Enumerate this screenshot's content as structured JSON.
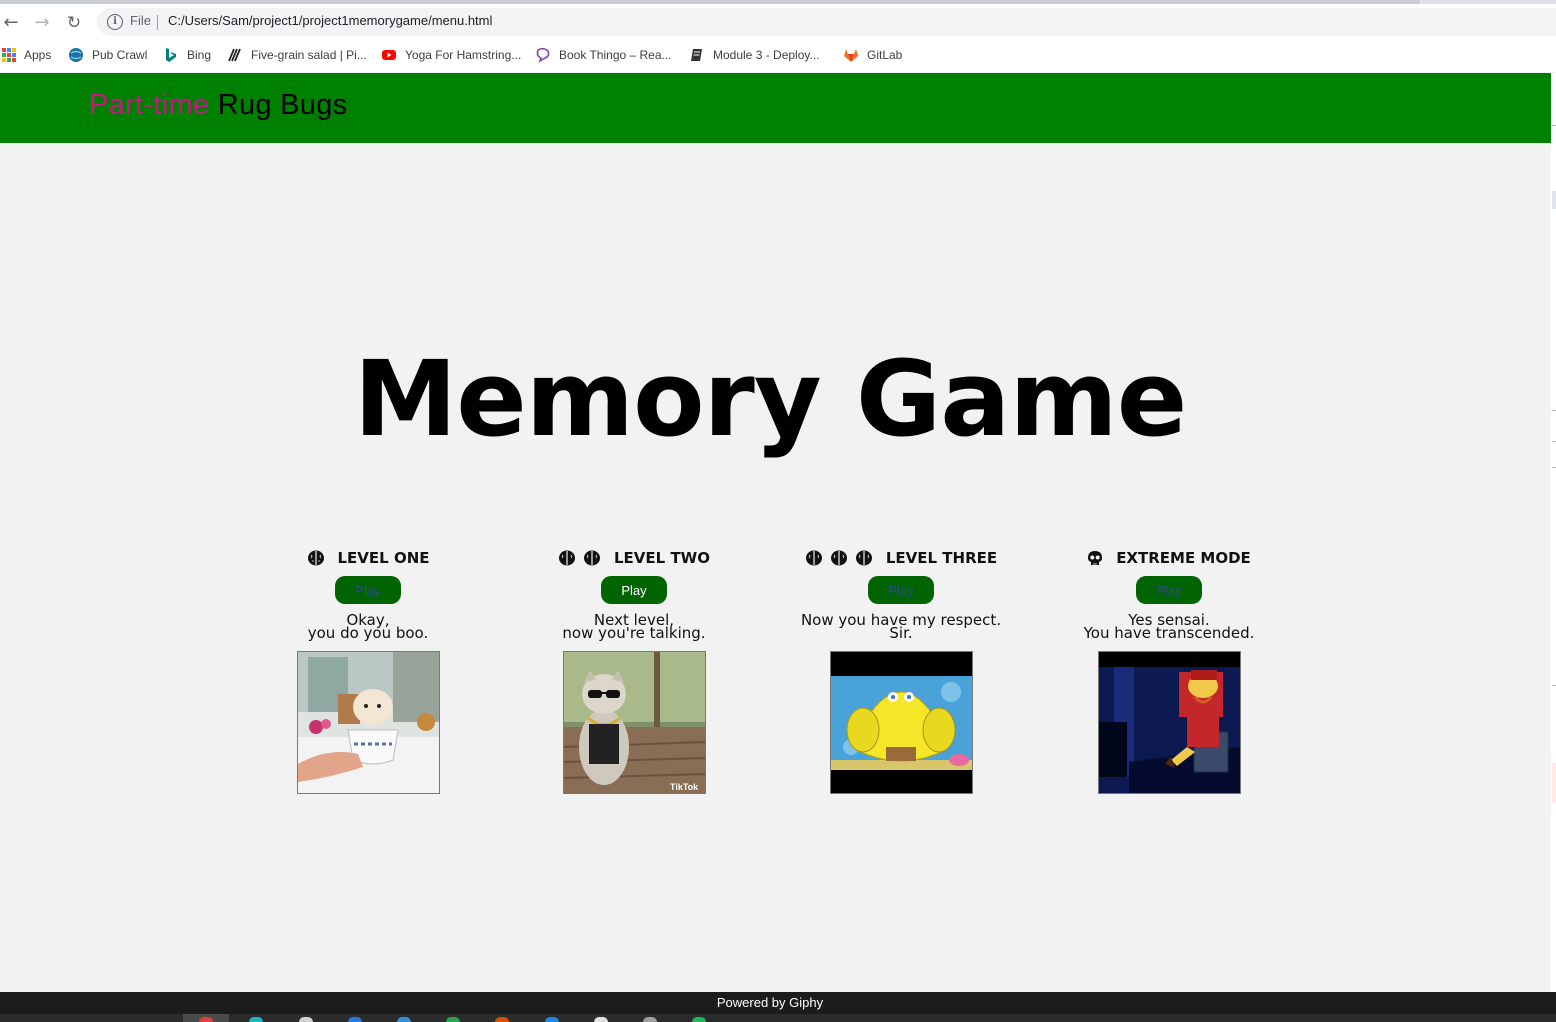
{
  "browser": {
    "url_scheme_label": "File",
    "url": "C:/Users/Sam/project1/project1memorygame/menu.html",
    "bookmarks": [
      {
        "label": "Apps",
        "icon": "apps-grid-icon"
      },
      {
        "label": "Pub Crawl",
        "icon": "globe-icon"
      },
      {
        "label": "Bing",
        "icon": "bing-icon"
      },
      {
        "label": "Five-grain salad | Pi...",
        "icon": "fork-icon"
      },
      {
        "label": "Yoga For Hamstring...",
        "icon": "youtube-icon"
      },
      {
        "label": "Book Thingo – Rea...",
        "icon": "chat-bubble-icon"
      },
      {
        "label": "Module 3 - Deploy...",
        "icon": "notebook-icon"
      },
      {
        "label": "GitLab",
        "icon": "gitlab-icon"
      }
    ]
  },
  "header": {
    "brand_accent": "Part-time",
    "brand_main": "Rug Bugs",
    "background_color": "#008000",
    "accent_color": "#c71585"
  },
  "main": {
    "title": "Memory Game"
  },
  "levels": [
    {
      "label": "LEVEL ONE",
      "icon": "brain-icon",
      "icon_count": 1,
      "play_label": "Play",
      "desc_line1": "Okay,",
      "desc_line2": "you do you boo.",
      "gif": "puppy-in-teacup"
    },
    {
      "label": "LEVEL TWO",
      "icon": "brain-icon",
      "icon_count": 2,
      "play_label": "Play",
      "desc_line1": "Next level,",
      "desc_line2": "now you're talking.",
      "gif": "cat-in-sunglasses"
    },
    {
      "label": "LEVEL THREE",
      "icon": "brain-icon",
      "icon_count": 3,
      "play_label": "Play",
      "desc_line1": "Now you have my respect.",
      "desc_line2": "Sir.",
      "gif": "muscular-sponge"
    },
    {
      "label": "EXTREME MODE",
      "icon": "skull-icon",
      "icon_count": 1,
      "play_label": "Play",
      "desc_line1": "Yes sensai.",
      "desc_line2": "You have transcended.",
      "gif": "cartoon-old-man-on-chair"
    }
  ],
  "footer": {
    "text": "Powered by Giphy"
  }
}
